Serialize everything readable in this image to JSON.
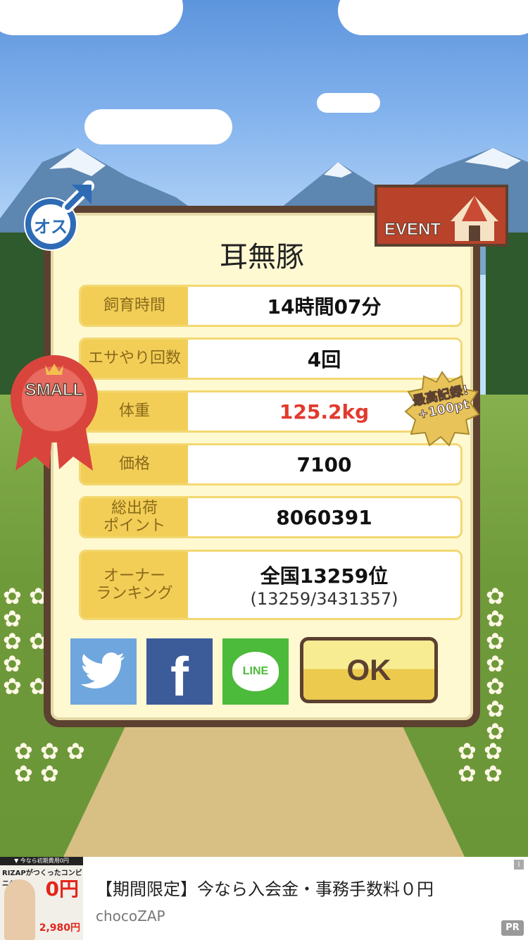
{
  "modal": {
    "title": "耳無豚",
    "rows": [
      {
        "label": "飼育時間",
        "value": "14時間07分"
      },
      {
        "label": "エサやり回数",
        "value": "4回"
      },
      {
        "label": "体重",
        "value": "125.2kg"
      },
      {
        "label": "価格",
        "value": "7100"
      },
      {
        "label": "総出荷\nポイント",
        "value": "8060391"
      },
      {
        "label": "オーナー\nランキング",
        "value": "全国13259位",
        "sub": "(13259/3431357)"
      }
    ],
    "share": {
      "twitter": "twitter-icon",
      "facebook_glyph": "f",
      "line_label": "LINE"
    },
    "ok_label": "OK"
  },
  "badges": {
    "gender": "オス",
    "event": "EVENT",
    "size": "SMALL",
    "record_line1": "最高記録!",
    "record_line2": "+100pt"
  },
  "ad": {
    "title": "【期間限定】今なら入会金・事務手数料０円",
    "advertiser": "chocoZAP",
    "pr": "PR",
    "info": "i",
    "image_banner": "▼ 今なら初期費用0円",
    "image_logo": "RIZAPがつくったコンビニジム",
    "image_zero": "0円",
    "image_price": "2,980円"
  },
  "colors": {
    "panel_border": "#5c4030",
    "label_bg": "#f3ce57",
    "highlight_red": "#e23a2e",
    "twitter": "#6fa6dd",
    "facebook": "#3c5b99",
    "line": "#4cba3a"
  }
}
